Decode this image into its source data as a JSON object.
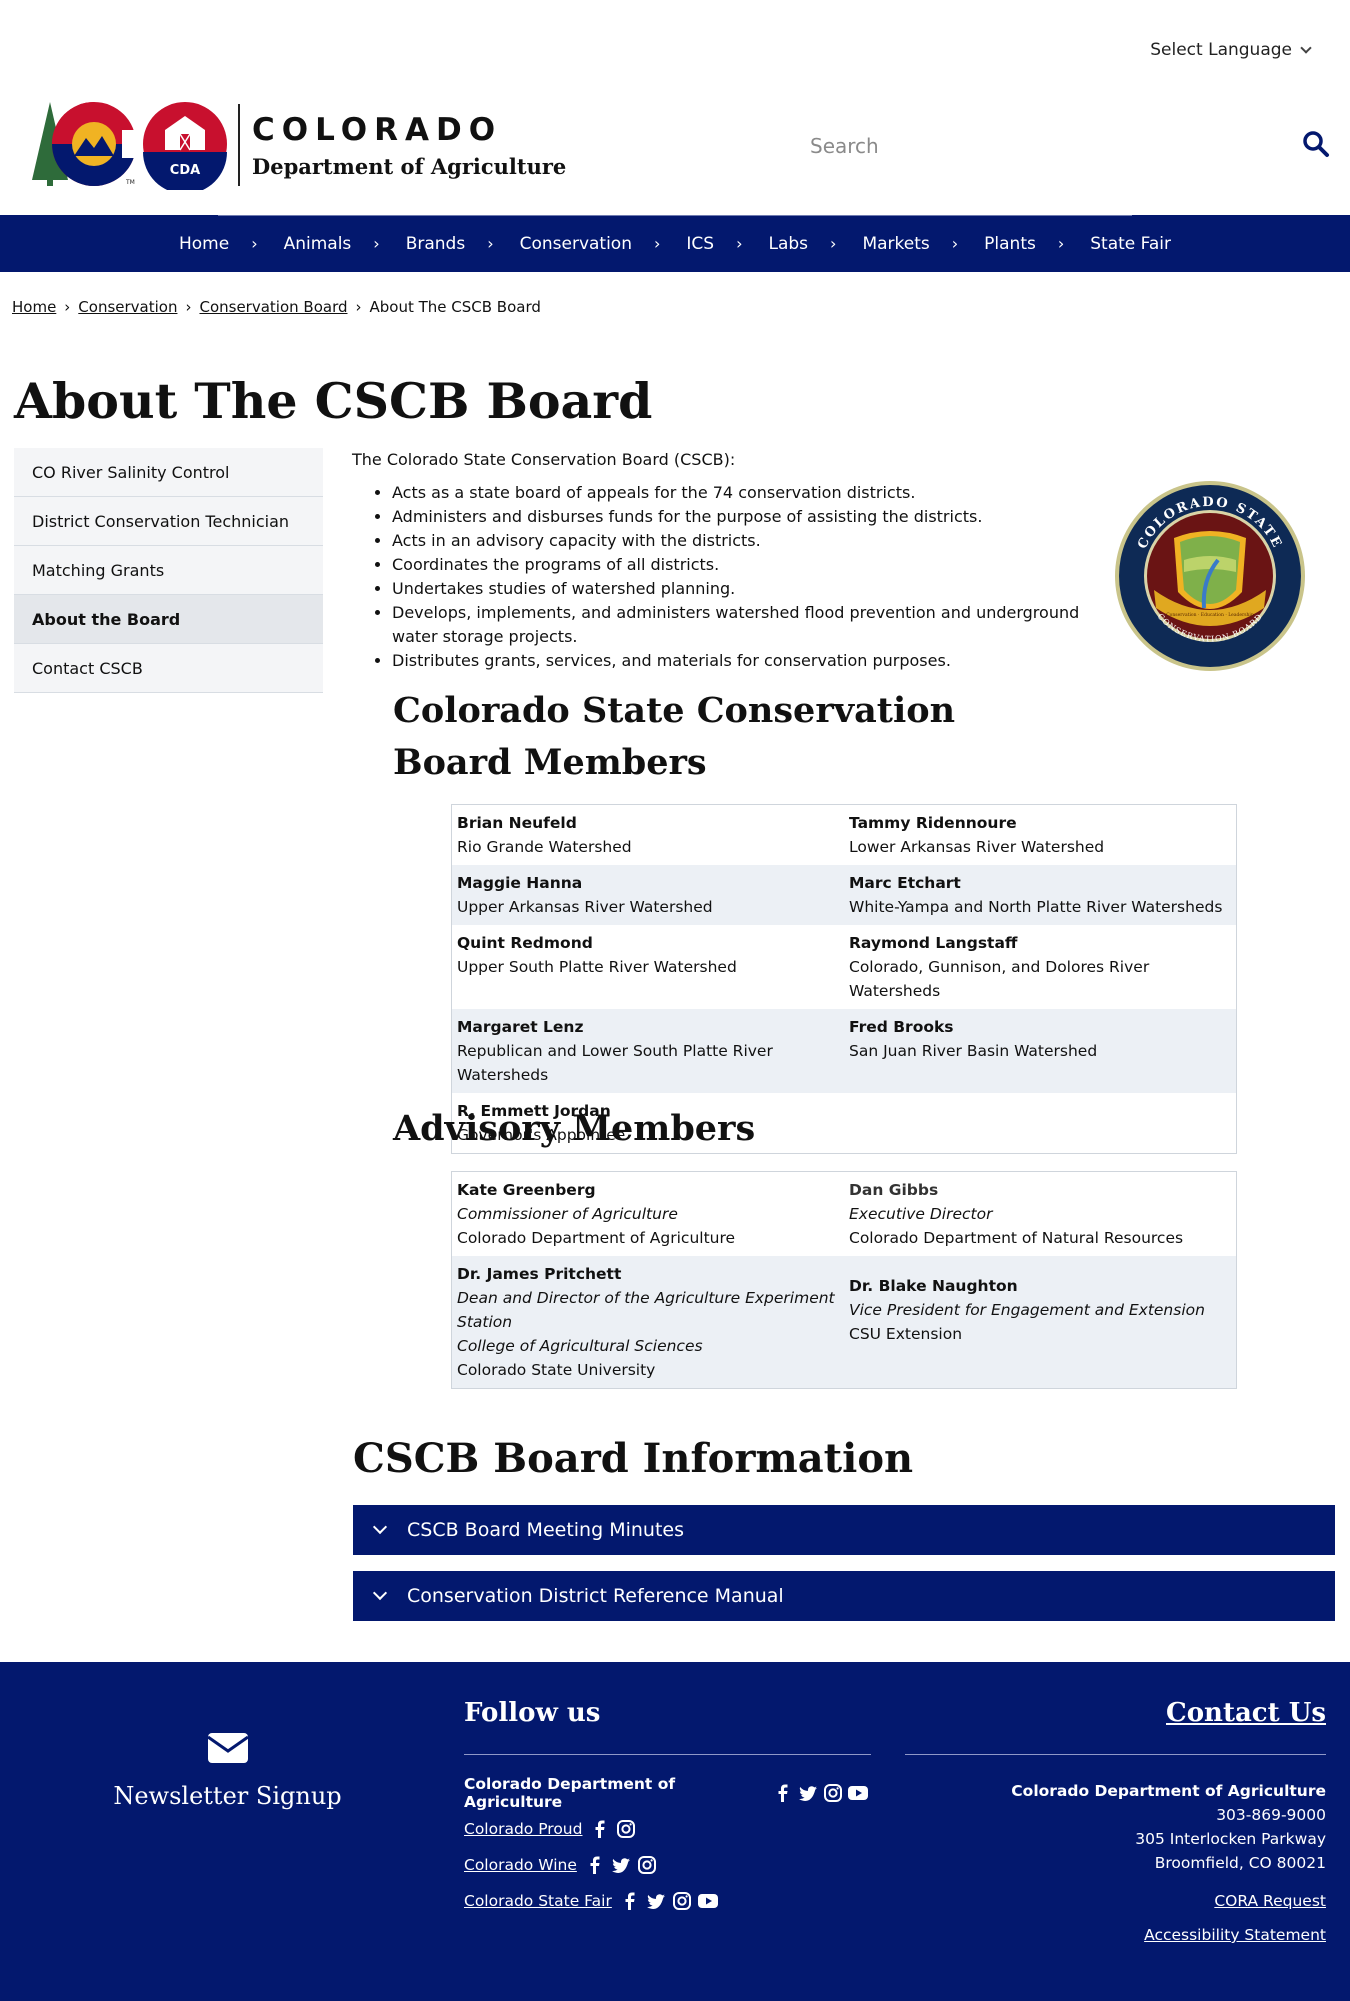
{
  "header": {
    "language_label": "Select Language",
    "brand_line1": "COLORADO",
    "brand_line2": "Department of Agriculture",
    "logo_badge": "CDA",
    "search_placeholder": "Search"
  },
  "nav": {
    "items": [
      "Home",
      "Animals",
      "Brands",
      "Conservation",
      "ICS",
      "Labs",
      "Markets",
      "Plants",
      "State Fair"
    ]
  },
  "breadcrumb": {
    "links": [
      "Home",
      "Conservation",
      "Conservation Board"
    ],
    "current": "About The CSCB Board"
  },
  "page_title": "About The CSCB Board",
  "sidenav": {
    "items": [
      "CO River Salinity Control",
      "District Conservation Technician",
      "Matching Grants",
      "About the Board",
      "Contact CSCB"
    ],
    "active": "About the Board"
  },
  "intro": "The Colorado State Conservation Board (CSCB):",
  "bullets": [
    "Acts as a state board of appeals for the 74 conservation districts.",
    "Administers and disburses funds for the purpose of assisting the districts.",
    "Acts in an advisory capacity with the districts.",
    "Coordinates the programs of all districts.",
    "Undertakes studies of watershed planning.",
    "Develops, implements, and administers watershed flood prevention and underground water storage projects.",
    "Distributes grants, services, and materials for conservation purposes."
  ],
  "seal": {
    "top_text": "COLORADO STATE",
    "bottom_text": "CONSERVATION BOARD",
    "ribbon": "Conservation · Education · Leadership"
  },
  "members_heading": "Colorado State Conservation Board Members",
  "members": [
    [
      {
        "name": "Brian Neufeld",
        "desc": "Rio Grande Watershed"
      },
      {
        "name": "Tammy Ridennoure",
        "desc": "Lower Arkansas River Watershed"
      }
    ],
    [
      {
        "name": "Maggie Hanna",
        "desc": "Upper Arkansas River Watershed"
      },
      {
        "name": "Marc Etchart",
        "desc": "White-Yampa and North Platte River Watersheds"
      }
    ],
    [
      {
        "name": "Quint Redmond",
        "desc": "Upper South Platte River Watershed"
      },
      {
        "name": "Raymond Langstaff",
        "desc": "Colorado, Gunnison, and Dolores River Watersheds"
      }
    ],
    [
      {
        "name": "Margaret Lenz",
        "desc": "Republican and Lower South Platte River Watersheds"
      },
      {
        "name": "Fred Brooks",
        "desc": "San Juan River Basin Watershed"
      }
    ],
    [
      {
        "name": "R. Emmett Jordan",
        "desc": "Governor's Appointee"
      }
    ]
  ],
  "advisory_heading": "Advisory Members",
  "advisory": {
    "kate": {
      "name": "Kate Greenberg",
      "role": "Commissioner of Agriculture",
      "org": "Colorado Department of Agriculture"
    },
    "dan": {
      "name": "Dan Gibbs",
      "role": "Executive Director",
      "org": "Colorado Department of Natural Resources"
    },
    "james": {
      "name": "Dr. James Pritchett",
      "role": "Dean and Director of the Agriculture Experiment Station",
      "college": "College of Agricultural Sciences",
      "org": "Colorado State University"
    },
    "blake": {
      "name": "Dr. Blake Naughton",
      "role": "Vice President for Engagement and Extension",
      "org": "CSU Extension"
    }
  },
  "info_heading": "CSCB Board Information",
  "accordions": [
    "CSCB Board Meeting Minutes",
    "Conservation District Reference Manual"
  ],
  "footer": {
    "newsletter": "Newsletter Signup",
    "follow_heading": "Follow us",
    "social": [
      {
        "name": "Colorado Department of Agriculture",
        "icons": [
          "facebook-icon",
          "twitter-icon",
          "instagram-icon",
          "youtube-icon"
        ]
      },
      {
        "name": "Colorado Proud",
        "icons": [
          "facebook-icon",
          "instagram-icon"
        ]
      },
      {
        "name": "Colorado Wine",
        "icons": [
          "facebook-icon",
          "twitter-icon",
          "instagram-icon"
        ]
      },
      {
        "name": "Colorado State Fair",
        "icons": [
          "facebook-icon",
          "twitter-icon",
          "instagram-icon",
          "youtube-icon"
        ]
      }
    ],
    "contact_heading": "Contact Us",
    "org": "Colorado Department of Agriculture",
    "phone": "303-869-9000",
    "address1": "305 Interlocken Parkway",
    "address2": "Broomfield, CO 80021",
    "cora": "CORA Request",
    "accessibility": "Accessibility Statement"
  },
  "colors": {
    "navy": "#03186e",
    "red": "#c8102e",
    "gold": "#f0b323",
    "green": "#2e6b3a"
  }
}
